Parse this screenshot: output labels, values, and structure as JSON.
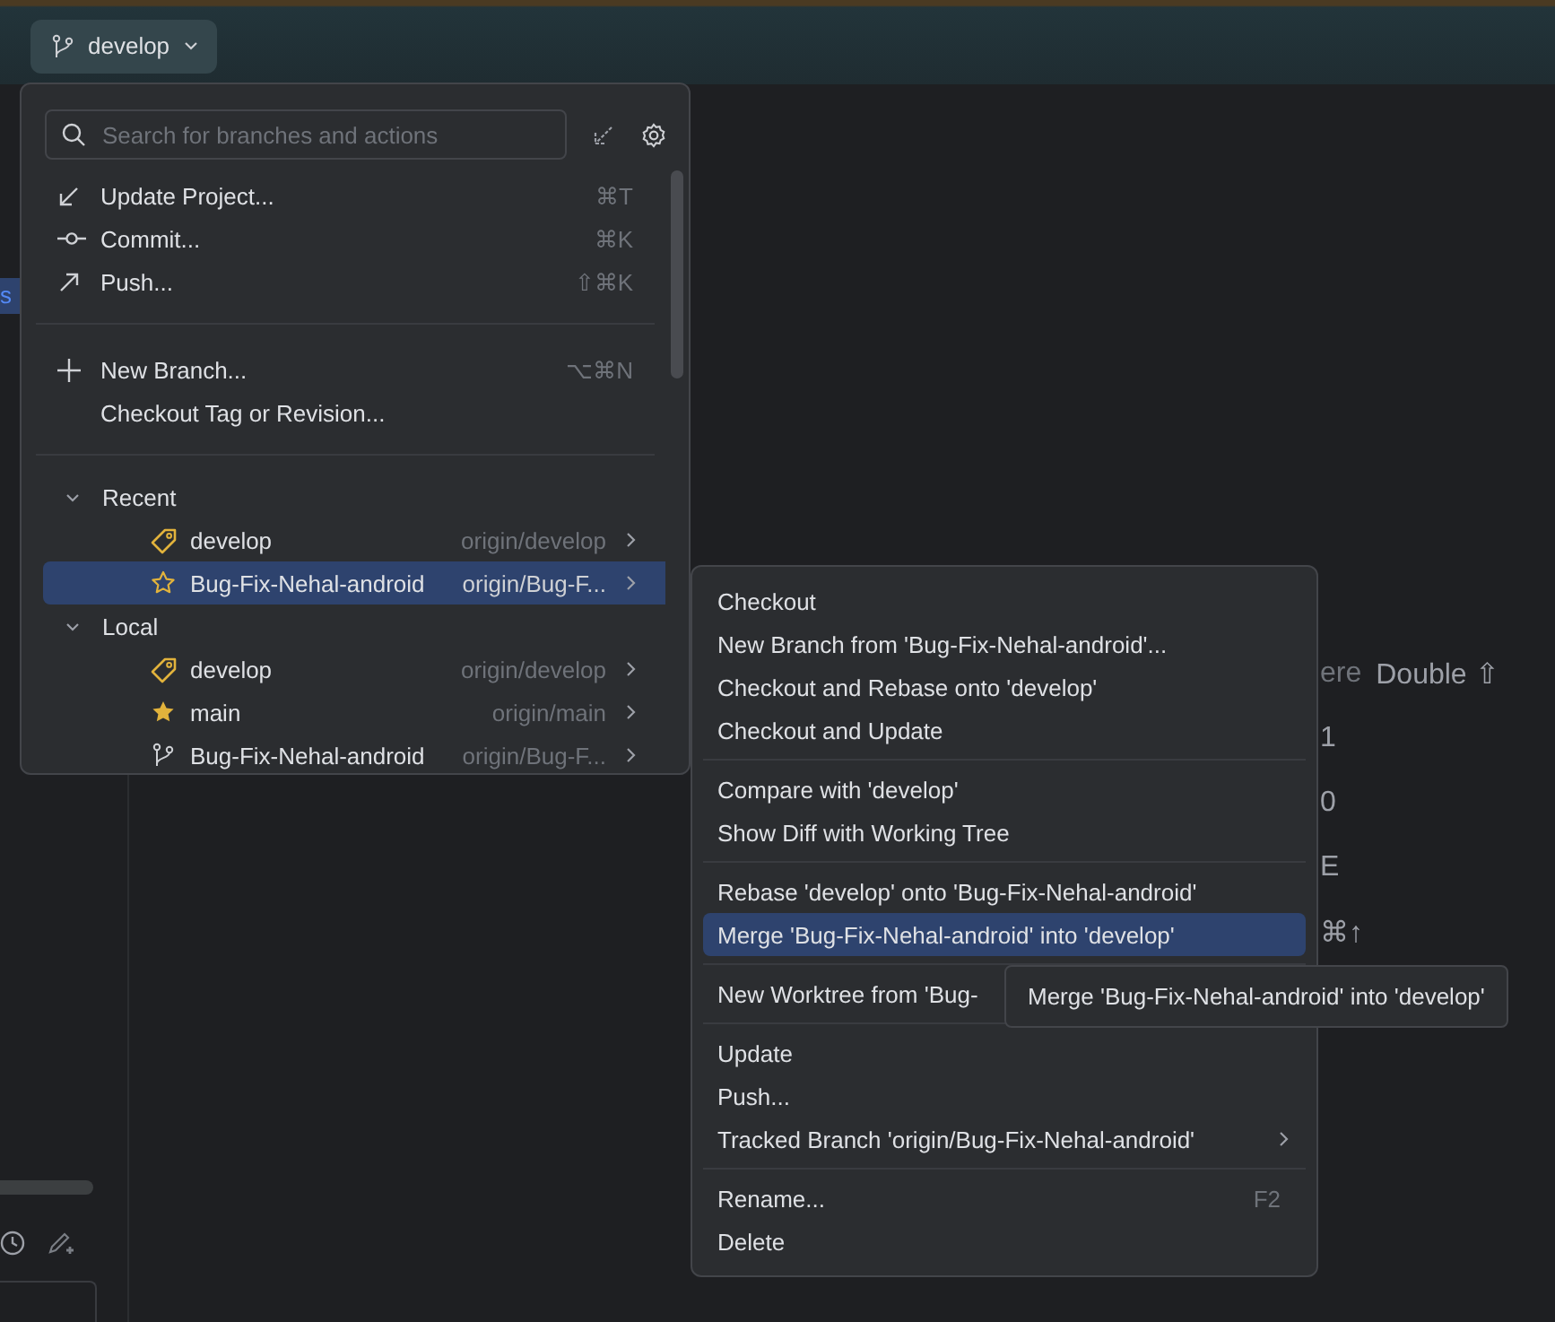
{
  "branch_button": {
    "label": "develop"
  },
  "sidebar": {
    "items": [
      {
        "label": "s",
        "selected": true
      }
    ]
  },
  "hints": [
    {
      "label": "ere",
      "keys": "Double ⇧"
    },
    {
      "keys": "1"
    },
    {
      "keys": "0"
    },
    {
      "keys": "E"
    },
    {
      "keys": "⌘↑"
    }
  ],
  "popup": {
    "search": {
      "placeholder": "Search for branches and actions"
    },
    "action_groups": [
      [
        {
          "label": "Update Project...",
          "shortcut": "⌘T",
          "kind": "update"
        },
        {
          "label": "Commit...",
          "shortcut": "⌘K",
          "kind": "commit"
        },
        {
          "label": "Push...",
          "shortcut": "⇧⌘K",
          "kind": "push"
        }
      ],
      [
        {
          "label": "New Branch...",
          "shortcut": "⌥⌘N",
          "kind": "new"
        },
        {
          "label": "Checkout Tag or Revision..."
        }
      ]
    ],
    "tree": [
      {
        "label": "Recent",
        "expanded": true,
        "children": [
          {
            "label": "develop",
            "remote": "origin/develop",
            "kind": "tag",
            "selected": false
          },
          {
            "label": "Bug-Fix-Nehal-android",
            "remote": "origin/Bug-F...",
            "kind": "favorite",
            "selected": true
          }
        ]
      },
      {
        "label": "Local",
        "expanded": true,
        "children": [
          {
            "label": "develop",
            "remote": "origin/develop",
            "kind": "tag",
            "selected": false
          },
          {
            "label": "main",
            "remote": "origin/main",
            "kind": "current",
            "selected": false
          },
          {
            "label": "Bug-Fix-Nehal-android",
            "remote": "origin/Bug-F...",
            "kind": "branch",
            "selected": false
          }
        ]
      }
    ]
  },
  "context_menu": {
    "groups": [
      [
        {
          "label": "Checkout",
          "selected": false
        },
        {
          "label": "New Branch from 'Bug-Fix-Nehal-android'...",
          "selected": false
        },
        {
          "label": "Checkout and Rebase onto 'develop'",
          "selected": false
        },
        {
          "label": "Checkout and Update",
          "selected": false
        }
      ],
      [
        {
          "label": "Compare with 'develop'",
          "selected": false
        },
        {
          "label": "Show Diff with Working Tree",
          "selected": false
        }
      ],
      [
        {
          "label": "Rebase 'develop' onto 'Bug-Fix-Nehal-android'",
          "selected": false
        },
        {
          "label": "Merge 'Bug-Fix-Nehal-android' into 'develop'",
          "selected": true
        }
      ],
      [
        {
          "label": "New Worktree from 'Bug-",
          "selected": false
        }
      ],
      [
        {
          "label": "Update",
          "selected": false
        },
        {
          "label": "Push...",
          "selected": false
        },
        {
          "label": "Tracked Branch 'origin/Bug-Fix-Nehal-android'",
          "selected": false,
          "submenu": true
        }
      ],
      [
        {
          "label": "Rename...",
          "shortcut": "F2",
          "selected": false
        },
        {
          "label": "Delete",
          "selected": false
        }
      ]
    ]
  },
  "tooltip": {
    "text": "Merge 'Bug-Fix-Nehal-android' into 'develop'"
  }
}
